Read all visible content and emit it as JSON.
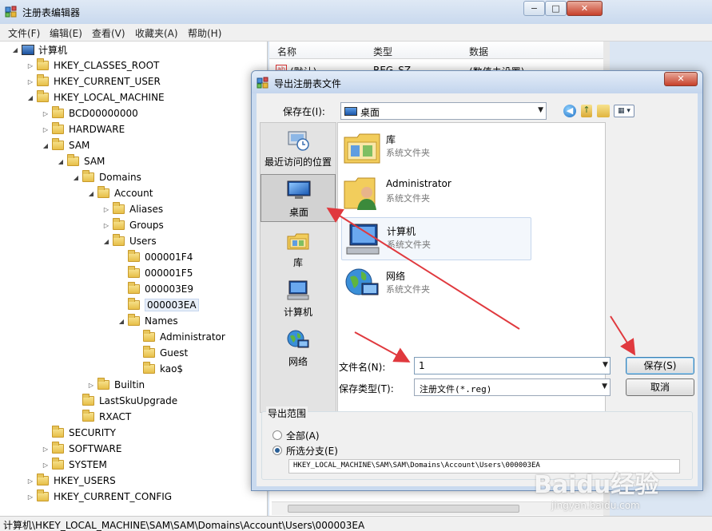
{
  "main_window": {
    "title": "注册表编辑器",
    "controls": {
      "minimize": "−",
      "maximize": "□",
      "close": "✕"
    },
    "menu": [
      "文件(F)",
      "编辑(E)",
      "查看(V)",
      "收藏夹(A)",
      "帮助(H)"
    ],
    "tree": [
      {
        "label": "计算机",
        "indent": 0,
        "arrow": "◢",
        "icon": "computer"
      },
      {
        "label": "HKEY_CLASSES_ROOT",
        "indent": 1,
        "arrow": "▷"
      },
      {
        "label": "HKEY_CURRENT_USER",
        "indent": 1,
        "arrow": "▷"
      },
      {
        "label": "HKEY_LOCAL_MACHINE",
        "indent": 1,
        "arrow": "◢"
      },
      {
        "label": "BCD00000000",
        "indent": 2,
        "arrow": "▷"
      },
      {
        "label": "HARDWARE",
        "indent": 2,
        "arrow": "▷"
      },
      {
        "label": "SAM",
        "indent": 2,
        "arrow": "◢"
      },
      {
        "label": "SAM",
        "indent": 3,
        "arrow": "◢"
      },
      {
        "label": "Domains",
        "indent": 4,
        "arrow": "◢"
      },
      {
        "label": "Account",
        "indent": 5,
        "arrow": "◢"
      },
      {
        "label": "Aliases",
        "indent": 6,
        "arrow": "▷"
      },
      {
        "label": "Groups",
        "indent": 6,
        "arrow": "▷"
      },
      {
        "label": "Users",
        "indent": 6,
        "arrow": "◢"
      },
      {
        "label": "000001F4",
        "indent": 7,
        "arrow": ""
      },
      {
        "label": "000001F5",
        "indent": 7,
        "arrow": ""
      },
      {
        "label": "000003E9",
        "indent": 7,
        "arrow": ""
      },
      {
        "label": "000003EA",
        "indent": 7,
        "arrow": "",
        "selected": true
      },
      {
        "label": "Names",
        "indent": 7,
        "arrow": "◢"
      },
      {
        "label": "Administrator",
        "indent": 8,
        "arrow": ""
      },
      {
        "label": "Guest",
        "indent": 8,
        "arrow": ""
      },
      {
        "label": "kao$",
        "indent": 8,
        "arrow": ""
      },
      {
        "label": "Builtin",
        "indent": 5,
        "arrow": "▷"
      },
      {
        "label": "LastSkuUpgrade",
        "indent": 4,
        "arrow": ""
      },
      {
        "label": "RXACT",
        "indent": 4,
        "arrow": ""
      },
      {
        "label": "SECURITY",
        "indent": 2,
        "arrow": ""
      },
      {
        "label": "SOFTWARE",
        "indent": 2,
        "arrow": "▷"
      },
      {
        "label": "SYSTEM",
        "indent": 2,
        "arrow": "▷"
      },
      {
        "label": "HKEY_USERS",
        "indent": 1,
        "arrow": "▷"
      },
      {
        "label": "HKEY_CURRENT_CONFIG",
        "indent": 1,
        "arrow": "▷"
      }
    ],
    "list": {
      "columns": [
        "名称",
        "类型",
        "数据"
      ],
      "rows": [
        {
          "name": "(默认)",
          "type": "REG_SZ",
          "data": "(数值未设置)"
        }
      ]
    },
    "status": "计算机\\HKEY_LOCAL_MACHINE\\SAM\\SAM\\Domains\\Account\\Users\\000003EA"
  },
  "dialog": {
    "title": "导出注册表文件",
    "close": "✕",
    "save_in_label": "保存在(I):",
    "save_in_value": "桌面",
    "places": [
      {
        "label": "最近访问的位置",
        "icon": "recent"
      },
      {
        "label": "桌面",
        "icon": "desktop",
        "selected": true
      },
      {
        "label": "库",
        "icon": "library"
      },
      {
        "label": "计算机",
        "icon": "computer"
      },
      {
        "label": "网络",
        "icon": "network"
      }
    ],
    "files": [
      {
        "name": "库",
        "type": "系统文件夹",
        "icon": "library"
      },
      {
        "name": "Administrator",
        "type": "系统文件夹",
        "icon": "user-folder"
      },
      {
        "name": "计算机",
        "type": "系统文件夹",
        "icon": "computer",
        "selected": true
      },
      {
        "name": "网络",
        "type": "系统文件夹",
        "icon": "network"
      }
    ],
    "filename_label": "文件名(N):",
    "filename_value": "1",
    "filetype_label": "保存类型(T):",
    "filetype_value": "注册文件(*.reg)",
    "save_button": "保存(S)",
    "cancel_button": "取消",
    "export_range": {
      "title": "导出范围",
      "all_label": "全部(A)",
      "branch_label": "所选分支(E)",
      "selected": "branch",
      "branch_value": "HKEY_LOCAL_MACHINE\\SAM\\SAM\\Domains\\Account\\Users\\000003EA"
    }
  },
  "watermark": {
    "logo": "Baidu经验",
    "url": "jingyan.baidu.com"
  },
  "colors": {
    "annotation_arrow": "#e0393e",
    "selection": "#c5d6ec",
    "title_bar": "#c9d9ee"
  }
}
